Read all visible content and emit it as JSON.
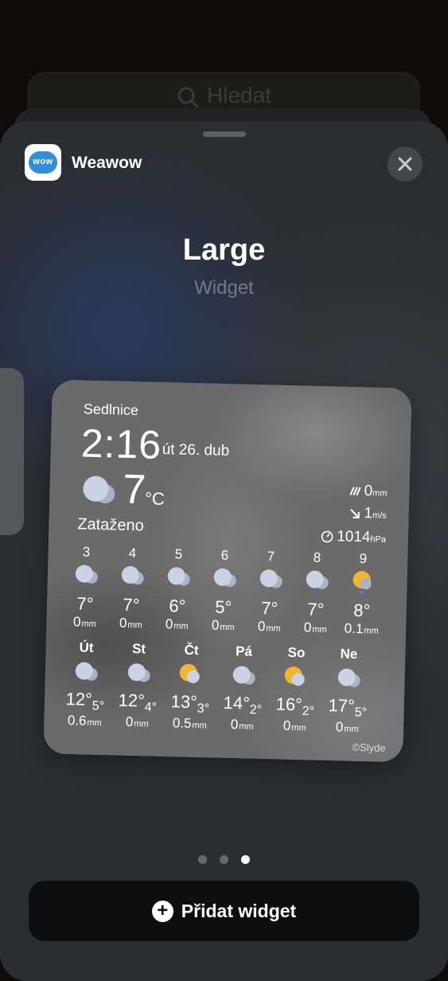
{
  "search": {
    "placeholder_text": "Hledat"
  },
  "sheet": {
    "app_name": "Weawow",
    "app_icon_text": "wow",
    "size_title": "Large",
    "size_subtitle": "Widget",
    "page_dots": {
      "count": 3,
      "active_index": 2
    },
    "add_button_label": "Přidat widget"
  },
  "widget": {
    "city": "Sedlnice",
    "time": "2:16",
    "date": "út 26. dub",
    "current_temp": "7",
    "temp_unit": "°C",
    "condition": "Zataženo",
    "precip": {
      "value": "0",
      "unit": "mm"
    },
    "wind": {
      "value": "1",
      "unit": "m/s"
    },
    "pressure": {
      "value": "1014",
      "unit": "hPa"
    },
    "hourly": [
      {
        "hour": "3",
        "temp": "7°",
        "precip": "0",
        "unit": "mm",
        "icon": "cloudy-icon"
      },
      {
        "hour": "4",
        "temp": "7°",
        "precip": "0",
        "unit": "mm",
        "icon": "cloudy-icon"
      },
      {
        "hour": "5",
        "temp": "6°",
        "precip": "0",
        "unit": "mm",
        "icon": "cloudy-icon"
      },
      {
        "hour": "6",
        "temp": "5°",
        "precip": "0",
        "unit": "mm",
        "icon": "cloudy-icon"
      },
      {
        "hour": "7",
        "temp": "7°",
        "precip": "0",
        "unit": "mm",
        "icon": "cloudy-icon"
      },
      {
        "hour": "8",
        "temp": "7°",
        "precip": "0",
        "unit": "mm",
        "icon": "cloudy-icon"
      },
      {
        "hour": "9",
        "temp": "8°",
        "precip": "0.1",
        "unit": "mm",
        "icon": "sun-rain-icon"
      }
    ],
    "daily": [
      {
        "day": "Út",
        "high": "12°",
        "low": "5°",
        "precip": "0.6",
        "unit": "mm",
        "icon": "cloudy-icon"
      },
      {
        "day": "St",
        "high": "12°",
        "low": "4°",
        "precip": "0",
        "unit": "mm",
        "icon": "cloudy-icon"
      },
      {
        "day": "Čt",
        "high": "13°",
        "low": "3°",
        "precip": "0.5",
        "unit": "mm",
        "icon": "partly-sunny-icon"
      },
      {
        "day": "Pá",
        "high": "14°",
        "low": "2°",
        "precip": "0",
        "unit": "mm",
        "icon": "cloudy-icon"
      },
      {
        "day": "So",
        "high": "16°",
        "low": "2°",
        "precip": "0",
        "unit": "mm",
        "icon": "partly-sunny-icon"
      },
      {
        "day": "Ne",
        "high": "17°",
        "low": "5°",
        "precip": "0",
        "unit": "mm",
        "icon": "cloudy-icon"
      }
    ],
    "copyright": "©Slyde"
  },
  "colors": {
    "sun": "#f2b531",
    "cloud": "#c9d3e3",
    "cloud_shadow": "#a9b3c3",
    "rain": "#3a8fe0"
  }
}
